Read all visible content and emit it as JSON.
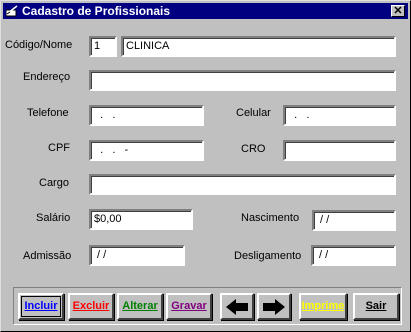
{
  "window": {
    "title": "Cadastro de Profissionais",
    "close_glyph": "✕"
  },
  "form": {
    "codigo_label": "Código/Nome",
    "codigo_value": "1",
    "nome_value": "CLINICA",
    "endereco_label": "Endereço",
    "endereco_value": "",
    "telefone_label": "Telefone",
    "telefone_value": "  .   .",
    "celular_label": "Celular",
    "celular_value": "  .   .",
    "cpf_label": "CPF",
    "cpf_value": "  .   .   -",
    "cro_label": "CRO",
    "cro_value": "",
    "cargo_label": "Cargo",
    "cargo_value": "",
    "salario_label": "Salário",
    "salario_value": "$0,00",
    "nascimento_label": "Nascimento",
    "nascimento_value": " / /",
    "admissao_label": "Admissão",
    "admissao_value": " / /",
    "desligamento_label": "Desligamento",
    "desligamento_value": " / /"
  },
  "toolbar": {
    "incluir": "Incluir",
    "excluir": "Excluir",
    "alterar": "Alterar",
    "gravar": "Gravar",
    "imprime": "Imprime",
    "sair": "Sair",
    "prev_icon": "arrow-left-icon",
    "next_icon": "arrow-right-icon"
  },
  "colors": {
    "titlebar": "#000080",
    "incluir": "#0000ff",
    "excluir": "#ff0000",
    "alterar": "#008000",
    "gravar": "#800080",
    "imprime": "#ffff00",
    "sair": "#000000"
  }
}
